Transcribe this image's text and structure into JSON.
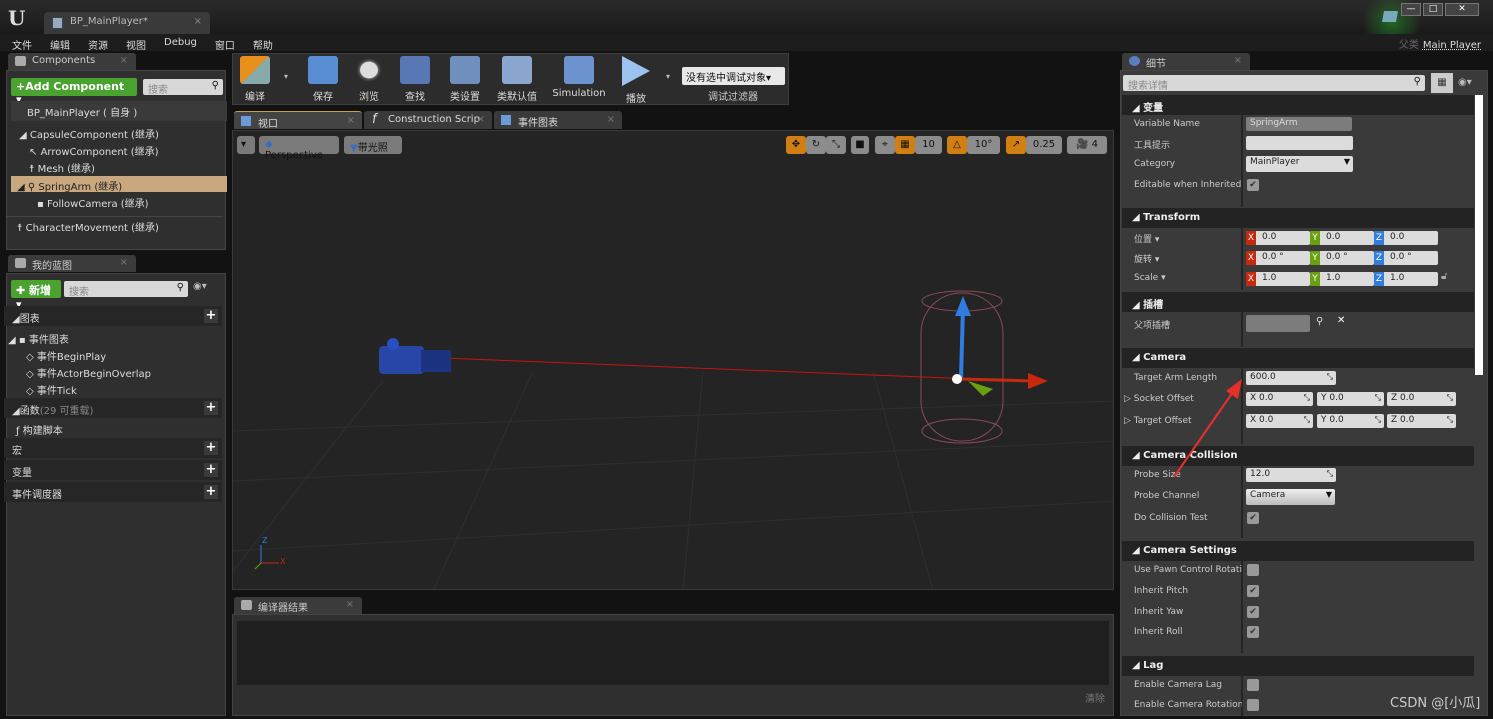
{
  "window": {
    "tab_title": "BP_MainPlayer*",
    "parent_label": "父类",
    "parent_value": "Main Player",
    "logo": "U"
  },
  "menu": [
    "文件",
    "编辑",
    "资源",
    "视图",
    "Debug",
    "窗口",
    "帮助"
  ],
  "components": {
    "tab": "Components",
    "add_button": "+Add Component ▾",
    "search_placeholder": "搜索",
    "root": "BP_MainPlayer ( 自身 )",
    "items": [
      "CapsuleComponent (继承)",
      "ArrowComponent (继承)",
      "Mesh (继承)",
      "SpringArm (继承)",
      "FollowCamera (继承)",
      "CharacterMovement (继承)"
    ]
  },
  "my_blueprint": {
    "tab": "我的蓝图",
    "new_button": "新增 ▾",
    "search_placeholder": "搜索",
    "graphs_section": "图表",
    "event_graph": "事件图表",
    "events": [
      "事件BeginPlay",
      "事件ActorBeginOverlap",
      "事件Tick"
    ],
    "functions_section": "函数",
    "functions_count": "(29 可重载)",
    "construction_script": "构建脚本",
    "macros_section": "宏",
    "variables_section": "变量",
    "dispatchers_section": "事件调度器"
  },
  "toolbar": {
    "compile": "编译",
    "save": "保存",
    "browse": "浏览",
    "find": "查找",
    "class_settings": "类设置",
    "class_defaults": "类默认值",
    "simulation": "Simulation",
    "play": "播放",
    "debug_select": "没有选中调试对象▾",
    "debug_filter": "调试过滤器"
  },
  "editor_tabs": [
    "视口",
    "Construction Scrip",
    "事件图表"
  ],
  "viewport": {
    "perspective": "Perspective",
    "lit": "带光照",
    "grid_snap": "10",
    "rot_snap": "10°",
    "scale_snap": "0.25",
    "cam_speed": "4",
    "axis_x": "X",
    "axis_z": "Z"
  },
  "compiler": {
    "tab": "编译器结果",
    "clear": "清除"
  },
  "details": {
    "tab": "细节",
    "search_placeholder": "搜索详情",
    "variable_section": "变量",
    "variable_name_label": "Variable Name",
    "variable_name": "SpringArm",
    "tooltip_label": "工具提示",
    "tooltip": "",
    "category_label": "Category",
    "category": "MainPlayer",
    "editable_label": "Editable when Inherited",
    "editable": true,
    "transform_section": "Transform",
    "location_label": "位置 ▾",
    "location": [
      "0.0",
      "0.0",
      "0.0"
    ],
    "rotation_label": "旋转 ▾",
    "rotation": [
      "0.0 °",
      "0.0 °",
      "0.0 °"
    ],
    "scale_label": "Scale ▾",
    "scale": [
      "1.0",
      "1.0",
      "1.0"
    ],
    "socket_section": "插槽",
    "parent_socket_label": "父项插槽",
    "camera_section": "Camera",
    "arm_length_label": "Target Arm Length",
    "arm_length": "600.0",
    "socket_offset_label": "Socket Offset",
    "socket_offset": [
      "X  0.0",
      "Y  0.0",
      "Z  0.0"
    ],
    "target_offset_label": "Target Offset",
    "target_offset": [
      "X  0.0",
      "Y  0.0",
      "Z  0.0"
    ],
    "collision_section": "Camera Collision",
    "probe_size_label": "Probe Size",
    "probe_size": "12.0",
    "probe_channel_label": "Probe Channel",
    "probe_channel": "Camera",
    "collision_test_label": "Do Collision Test",
    "collision_test": true,
    "settings_section": "Camera Settings",
    "pawn_rot_label": "Use Pawn Control Rotation",
    "pawn_rot": false,
    "pitch_label": "Inherit Pitch",
    "pitch": true,
    "yaw_label": "Inherit Yaw",
    "yaw": true,
    "roll_label": "Inherit Roll",
    "roll": true,
    "lag_section": "Lag",
    "cam_lag_label": "Enable Camera Lag",
    "cam_lag": false,
    "rot_lag_label": "Enable Camera Rotation Lag",
    "rot_lag": false
  },
  "watermark": "CSDN @[小瓜]",
  "colors": {
    "accent_orange": "#d17f12",
    "green": "#4ba32f",
    "axis_x": "#c8280c",
    "axis_y": "#6aa00f",
    "axis_z": "#2f7de0",
    "selection": "#c9a77f"
  }
}
